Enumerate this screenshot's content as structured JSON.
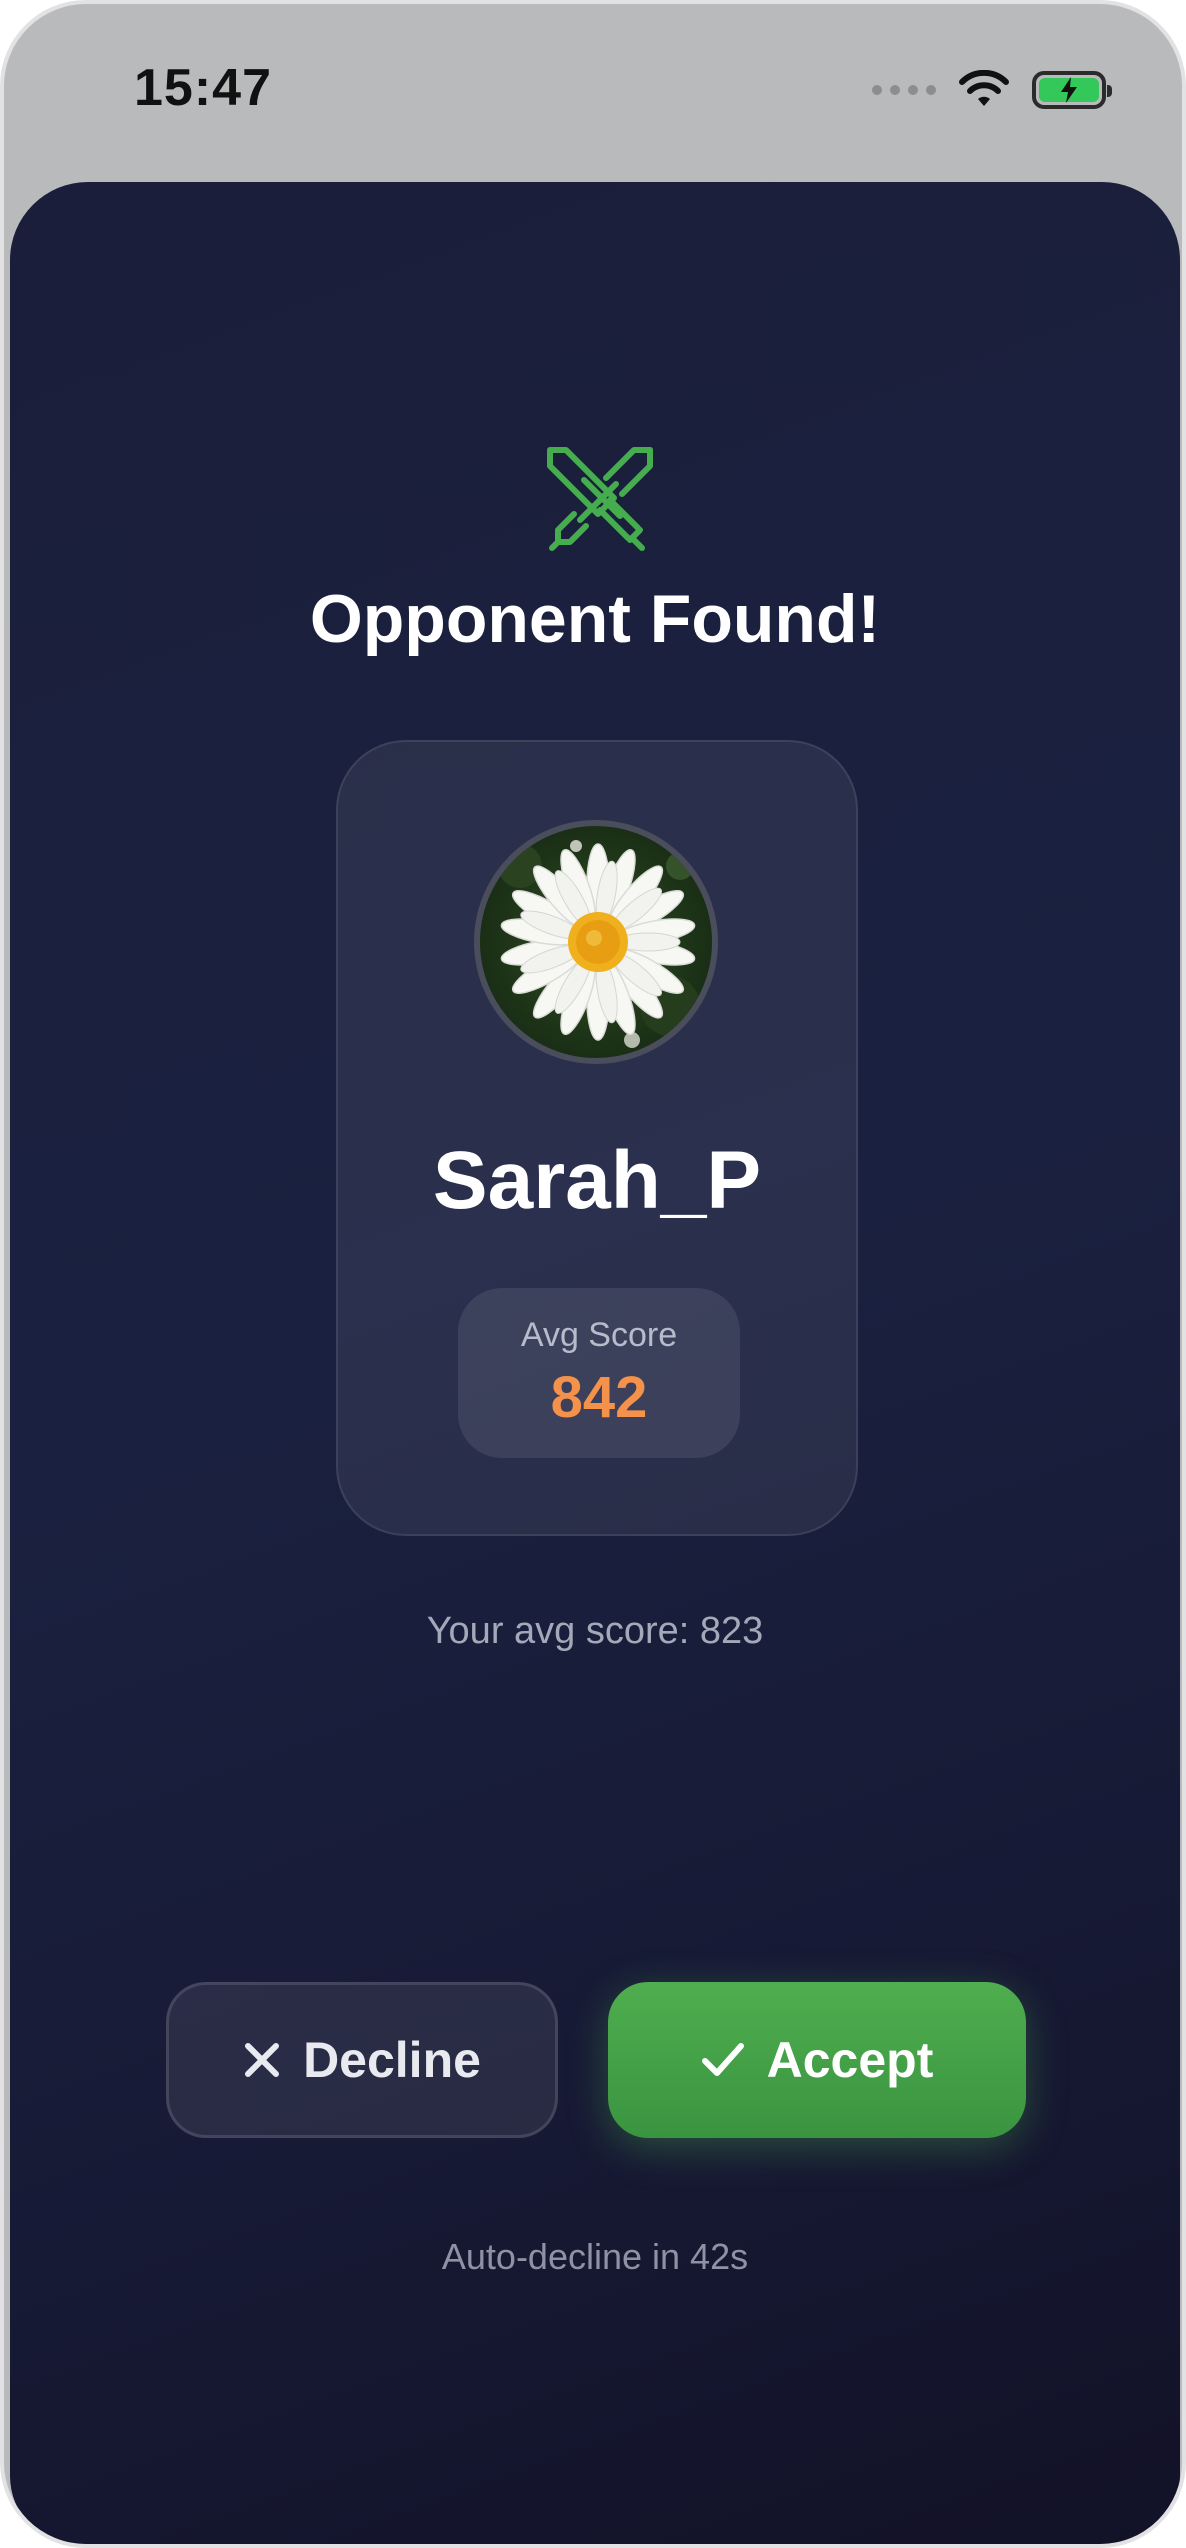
{
  "status_bar": {
    "time": "15:47"
  },
  "match": {
    "icon": "crossed-swords-icon",
    "title": "Opponent Found!",
    "opponent": {
      "name": "Sarah_P",
      "avatar": "daisy-flower-photo",
      "avg_score_label": "Avg Score",
      "avg_score": "842"
    },
    "your_score_text": "Your avg score: 823",
    "decline_label": "Decline",
    "accept_label": "Accept",
    "auto_decline_text": "Auto-decline in 42s"
  },
  "colors": {
    "accent_green": "#4CAF50",
    "score_orange": "#F4914A",
    "background": "#1A1F3C"
  }
}
